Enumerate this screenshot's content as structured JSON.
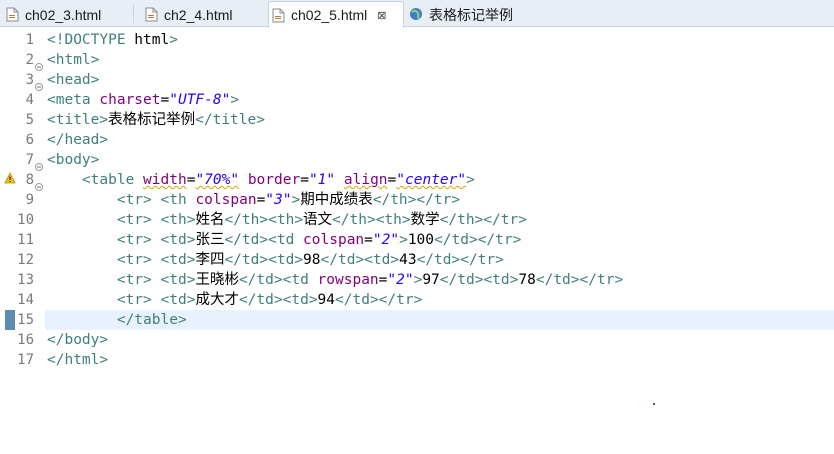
{
  "tabs": [
    {
      "label": "ch02_3.html",
      "icon": "html-file-icon",
      "active": false
    },
    {
      "label": "ch2_4.html",
      "icon": "html-file-icon",
      "active": false
    },
    {
      "label": "ch02_5.html",
      "icon": "html-file-icon",
      "active": true,
      "close": "⊠"
    },
    {
      "label": "表格标记举例",
      "icon": "browser-globe-icon",
      "active": false
    }
  ],
  "editor": {
    "current_line": 15,
    "lines": [
      {
        "n": "1",
        "text": "<!DOCTYPE html>"
      },
      {
        "n": "2",
        "text": "<html>"
      },
      {
        "n": "3",
        "text": "<head>"
      },
      {
        "n": "4",
        "text": "<meta charset=\"UTF-8\">"
      },
      {
        "n": "5",
        "text": "<title>表格标记举例</title>"
      },
      {
        "n": "6",
        "text": "</head>"
      },
      {
        "n": "7",
        "text": "<body>"
      },
      {
        "n": "8",
        "text": "    <table width=\"70%\" border=\"1\" align=\"center\">"
      },
      {
        "n": "9",
        "text": "        <tr> <th colspan=\"3\">期中成绩表</th></tr>"
      },
      {
        "n": "10",
        "text": "        <tr> <th>姓名</th><th>语文</th><th>数学</th></tr>"
      },
      {
        "n": "11",
        "text": "        <tr> <td>张三</td><td colspan=\"2\">100</td></tr>"
      },
      {
        "n": "12",
        "text": "        <tr> <td>李四</td><td>98</td><td>43</td></tr>"
      },
      {
        "n": "13",
        "text": "        <tr> <td>王晓彬</td><td rowspan=\"2\">97</td><td>78</td></tr>"
      },
      {
        "n": "14",
        "text": "        <tr> <td>成大才</td><td>94</td></tr>"
      },
      {
        "n": "15",
        "text": "        </table>"
      },
      {
        "n": "16",
        "text": "</body>"
      },
      {
        "n": "17",
        "text": "</html>"
      }
    ]
  },
  "colors": {
    "tag": "#3f7f7f",
    "attr": "#7f007f",
    "value": "#2a00ff",
    "text": "#000000",
    "current_line_bg": "#e8f2fe"
  }
}
